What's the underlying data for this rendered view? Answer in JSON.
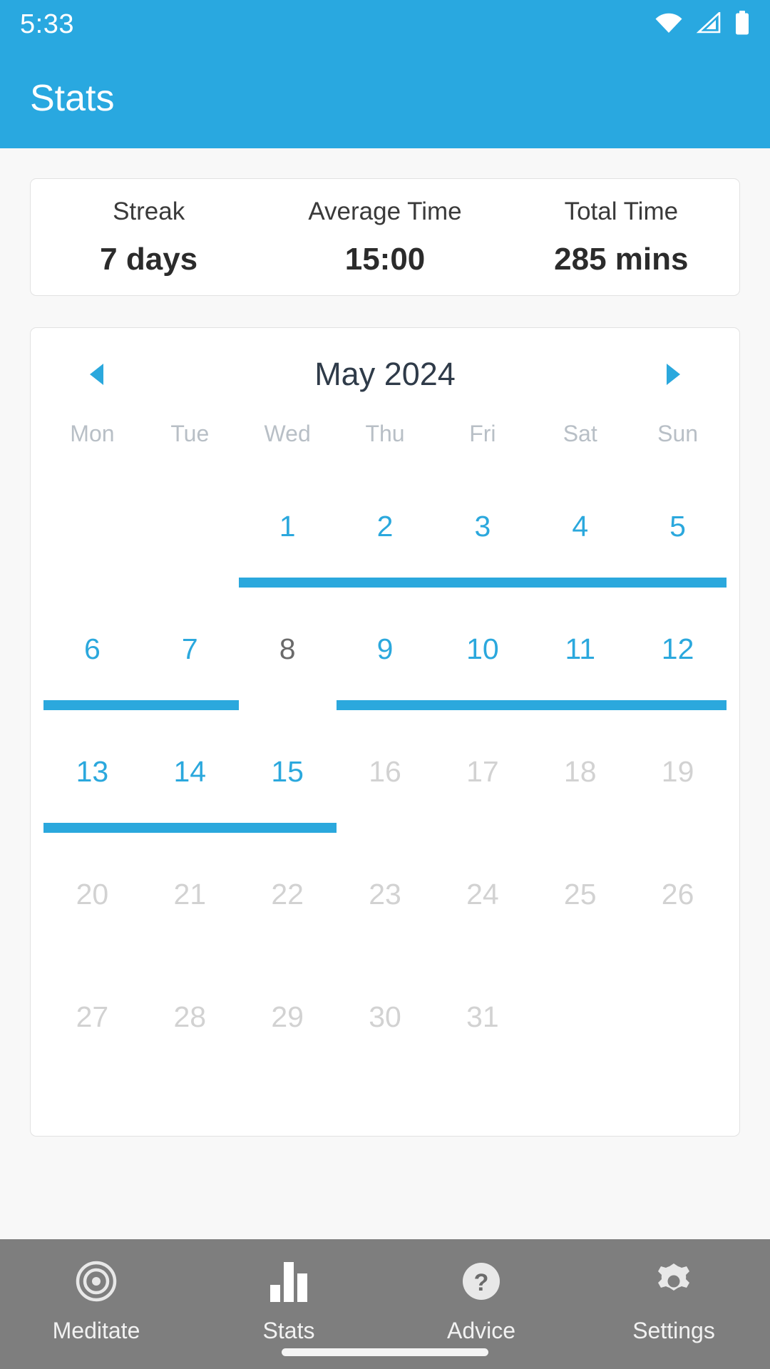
{
  "theme": {
    "accent": "#29a8e0",
    "accent_bar": "#2ba8dd",
    "page_bg": "#f8f8f8",
    "card_bg": "#ffffff",
    "nav_bg": "#7e7e7e",
    "day_future": "#d2d2d2",
    "day_past": "#6a6a6a"
  },
  "status_bar": {
    "clock": "5:33",
    "icons": [
      "wifi-icon",
      "cellular-signal-icon",
      "battery-icon"
    ]
  },
  "app_bar": {
    "title": "Stats"
  },
  "stats": {
    "cells": [
      {
        "label": "Streak",
        "value": "7 days"
      },
      {
        "label": "Average Time",
        "value": "15:00"
      },
      {
        "label": "Total Time",
        "value": "285 mins"
      }
    ]
  },
  "calendar": {
    "title": "May 2024",
    "prev_label": "prev-month-arrow",
    "next_label": "next-month-arrow",
    "weekdays": [
      "Mon",
      "Tue",
      "Wed",
      "Thu",
      "Fri",
      "Sat",
      "Sun"
    ],
    "weeks": [
      {
        "days": [
          {
            "label": "",
            "state": "empty"
          },
          {
            "label": "",
            "state": "empty"
          },
          {
            "label": "1",
            "state": "done"
          },
          {
            "label": "2",
            "state": "done"
          },
          {
            "label": "3",
            "state": "done"
          },
          {
            "label": "4",
            "state": "done"
          },
          {
            "label": "5",
            "state": "done"
          }
        ],
        "bars": [
          {
            "start": 2,
            "end": 6
          }
        ]
      },
      {
        "days": [
          {
            "label": "6",
            "state": "done"
          },
          {
            "label": "7",
            "state": "done"
          },
          {
            "label": "8",
            "state": "past"
          },
          {
            "label": "9",
            "state": "done"
          },
          {
            "label": "10",
            "state": "done"
          },
          {
            "label": "11",
            "state": "done"
          },
          {
            "label": "12",
            "state": "done"
          }
        ],
        "bars": [
          {
            "start": 0,
            "end": 1
          },
          {
            "start": 3,
            "end": 6
          }
        ]
      },
      {
        "days": [
          {
            "label": "13",
            "state": "done"
          },
          {
            "label": "14",
            "state": "done"
          },
          {
            "label": "15",
            "state": "done"
          },
          {
            "label": "16",
            "state": "future"
          },
          {
            "label": "17",
            "state": "future"
          },
          {
            "label": "18",
            "state": "future"
          },
          {
            "label": "19",
            "state": "future"
          }
        ],
        "bars": [
          {
            "start": 0,
            "end": 2
          }
        ]
      },
      {
        "days": [
          {
            "label": "20",
            "state": "future"
          },
          {
            "label": "21",
            "state": "future"
          },
          {
            "label": "22",
            "state": "future"
          },
          {
            "label": "23",
            "state": "future"
          },
          {
            "label": "24",
            "state": "future"
          },
          {
            "label": "25",
            "state": "future"
          },
          {
            "label": "26",
            "state": "future"
          }
        ],
        "bars": []
      },
      {
        "days": [
          {
            "label": "27",
            "state": "future"
          },
          {
            "label": "28",
            "state": "future"
          },
          {
            "label": "29",
            "state": "future"
          },
          {
            "label": "30",
            "state": "future"
          },
          {
            "label": "31",
            "state": "future"
          },
          {
            "label": "",
            "state": "empty"
          },
          {
            "label": "",
            "state": "empty"
          }
        ],
        "bars": []
      }
    ]
  },
  "bottom_nav": {
    "active": "Stats",
    "items": [
      {
        "label": "Meditate",
        "icon": "meditate-target-icon"
      },
      {
        "label": "Stats",
        "icon": "bar-chart-icon"
      },
      {
        "label": "Advice",
        "icon": "question-circle-icon"
      },
      {
        "label": "Settings",
        "icon": "gear-icon"
      }
    ]
  }
}
